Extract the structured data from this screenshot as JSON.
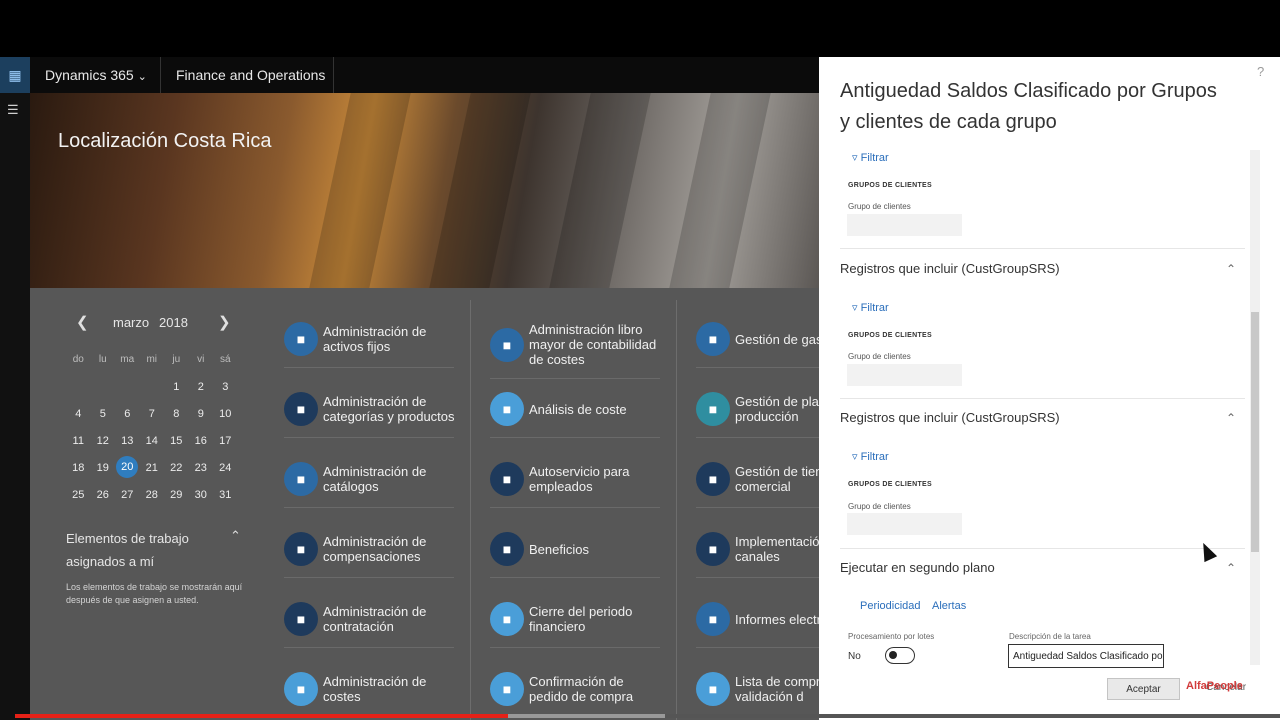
{
  "nav": {
    "app": "Dynamics 365",
    "module": "Finance and Operations"
  },
  "hero": {
    "title": "Localización Costa Rica"
  },
  "calendar": {
    "month": "marzo",
    "year": "2018",
    "dow": [
      "do",
      "lu",
      "ma",
      "mi",
      "ju",
      "vi",
      "sá"
    ],
    "days": [
      "",
      "",
      "",
      "",
      "1",
      "2",
      "3",
      "4",
      "5",
      "6",
      "7",
      "8",
      "9",
      "10",
      "11",
      "12",
      "13",
      "14",
      "15",
      "16",
      "17",
      "18",
      "19",
      "20",
      "21",
      "22",
      "23",
      "24",
      "25",
      "26",
      "27",
      "28",
      "29",
      "30",
      "31"
    ],
    "today": "20"
  },
  "work_items": {
    "title": "Elementos de trabajo asignados a mí",
    "desc": "Los elementos de trabajo se mostrarán aquí después de que asignen a usted."
  },
  "tiles": {
    "col1": [
      "Administración de activos fijos",
      "Administración de categorías y productos",
      "Administración de catálogos",
      "Administración de compensaciones",
      "Administración de contratación",
      "Administración de costes"
    ],
    "col2": [
      "Administración libro mayor de contabilidad de costes",
      "Análisis de coste",
      "Autoservicio para empleados",
      "Beneficios",
      "Cierre del periodo financiero",
      "Confirmación de pedido de compra"
    ],
    "col3": [
      "Gestión de gast",
      "Gestión de plan producción",
      "Gestión de tien comercial",
      "Implementació canales",
      "Informes electr",
      "Lista de compr de validación d"
    ]
  },
  "panel": {
    "title": "Antiguedad Saldos Clasificado por Grupos y clientes de cada grupo",
    "help": "?",
    "filtrar": "Filtrar",
    "grupos_header": "GRUPOS DE CLIENTES",
    "grupo_label": "Grupo de clientes",
    "section_registros": "Registros que incluir (CustGroupSRS)",
    "section_ejecutar": "Ejecutar en segundo plano",
    "tab_periodicidad": "Periodicidad",
    "tab_alertas": "Alertas",
    "batch_label": "Procesamiento por lotes",
    "batch_value": "No",
    "task_desc_label": "Descripción de la tarea",
    "task_desc_value": "Antiguedad Saldos Clasificado po",
    "accept": "Aceptar",
    "cancel": "Cancelar"
  },
  "watermark": "AlfaPeople",
  "video": {
    "progress": 0.39
  }
}
